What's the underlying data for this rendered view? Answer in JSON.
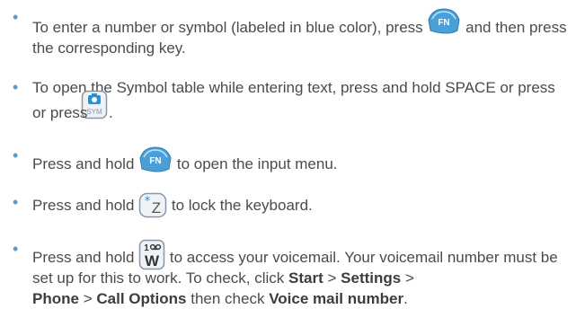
{
  "items": [
    {
      "parts": [
        "To enter a number or symbol (labeled in blue color), press",
        "and then press the corresponding key."
      ],
      "key": {
        "icon": "fn-key-icon",
        "label": "FN"
      }
    },
    {
      "parts": [
        "To open the Symbol table while entering text, press and hold SPACE or press",
        "."
      ],
      "key": {
        "icon": "sym-camera-key-icon",
        "label": "SYM"
      }
    },
    {
      "parts": [
        "Press and hold",
        "to open the input menu."
      ],
      "key": {
        "icon": "fn-key-icon",
        "label": "FN"
      }
    },
    {
      "parts": [
        "Press and hold",
        "to lock the keyboard."
      ],
      "key": {
        "icon": "star-z-key-icon",
        "label": "Z"
      }
    },
    {
      "parts": [
        "Press and hold",
        "to access your voicemail. Your voicemail number must be set up for this to work. To check, click",
        ">",
        ">",
        "then check",
        "."
      ],
      "key": {
        "icon": "voicemail-w-key-icon",
        "label": "W",
        "sublabel": "1"
      },
      "bold": [
        "Start",
        "Settings",
        "Phone",
        "Call Options",
        "Voice mail number"
      ]
    }
  ],
  "colors": {
    "bullet": "#5a9bc7",
    "key_blue": "#4a9fd4",
    "key_frame": "#8a96a6"
  }
}
